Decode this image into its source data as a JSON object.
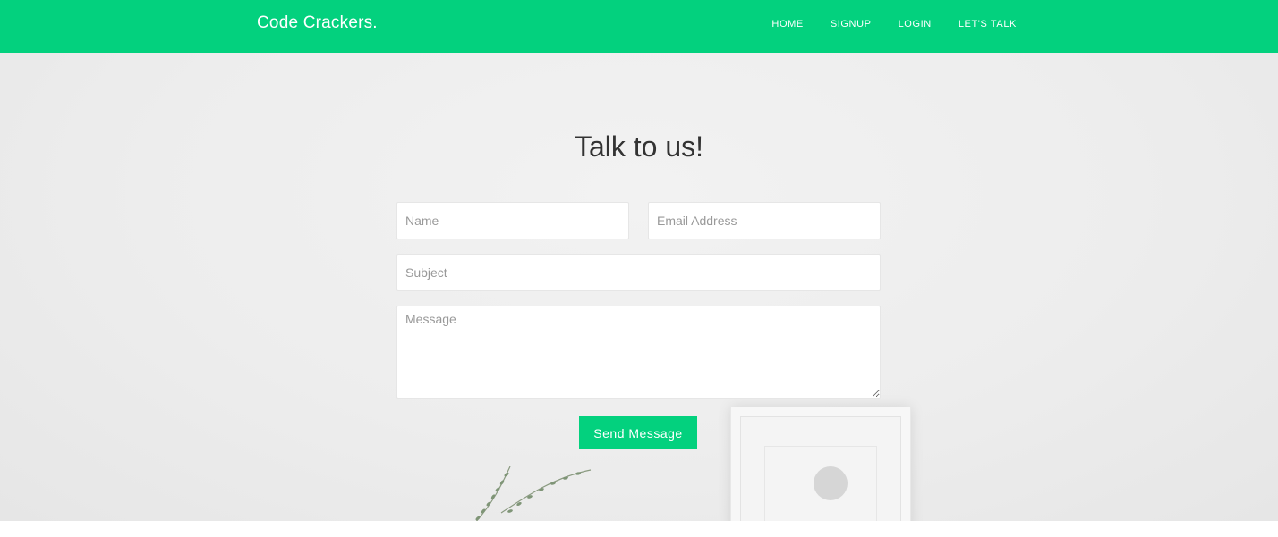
{
  "nav": {
    "brand": "Code Crackers.",
    "links": [
      "HOME",
      "SIGNUP",
      "LOGIN",
      "LET'S TALK"
    ]
  },
  "hero": {
    "title": "Talk to us!"
  },
  "form": {
    "name_placeholder": "Name",
    "email_placeholder": "Email Address",
    "subject_placeholder": "Subject",
    "message_placeholder": "Message",
    "submit_label": "Send Message"
  },
  "colors": {
    "accent": "#03d17e",
    "background": "#ededed",
    "title_text": "#333333"
  },
  "icons": {
    "decor_frame": "picture-frame-icon",
    "decor_plant": "plant-icon"
  }
}
